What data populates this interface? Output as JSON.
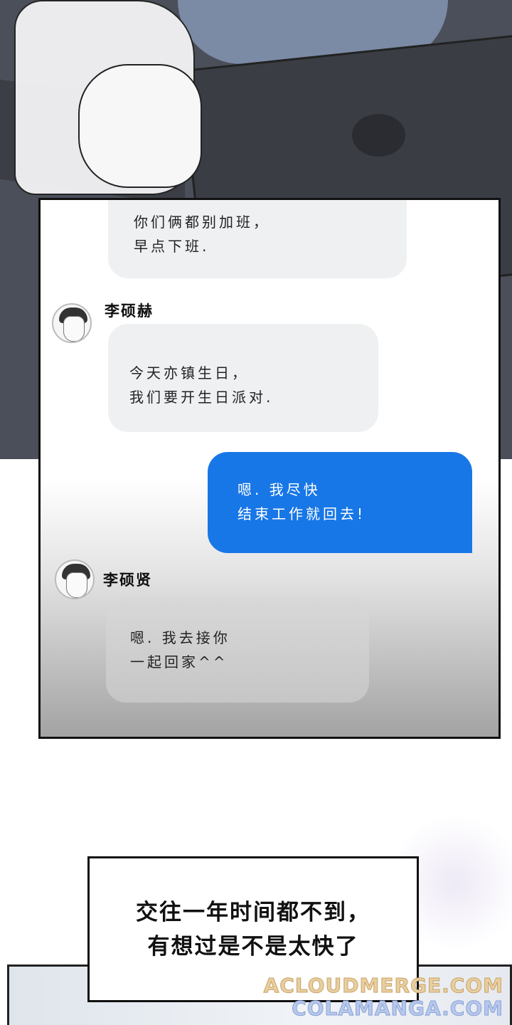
{
  "chat": {
    "messages": [
      {
        "side": "left",
        "sender": "",
        "text": "你们俩都别加班，\n早点下班."
      },
      {
        "side": "left",
        "sender": "李硕赫",
        "text": "今天亦镇生日，\n我们要开生日派对."
      },
      {
        "side": "right",
        "sender": "",
        "text": "嗯. 我尽快\n结束工作就回去!"
      },
      {
        "side": "left",
        "sender": "李硕贤",
        "text": "嗯. 我去接你\n一起回家^^"
      }
    ]
  },
  "caption": {
    "line1": "交往一年时间都不到，",
    "line2": "有想过是不是太快了"
  },
  "watermark": {
    "line1": "ACLOUDMERGE.COM",
    "line2": "COLAMANGA.COM"
  },
  "colors": {
    "outgoing_bubble": "#1877e6",
    "incoming_bubble": "#eef0f2"
  }
}
